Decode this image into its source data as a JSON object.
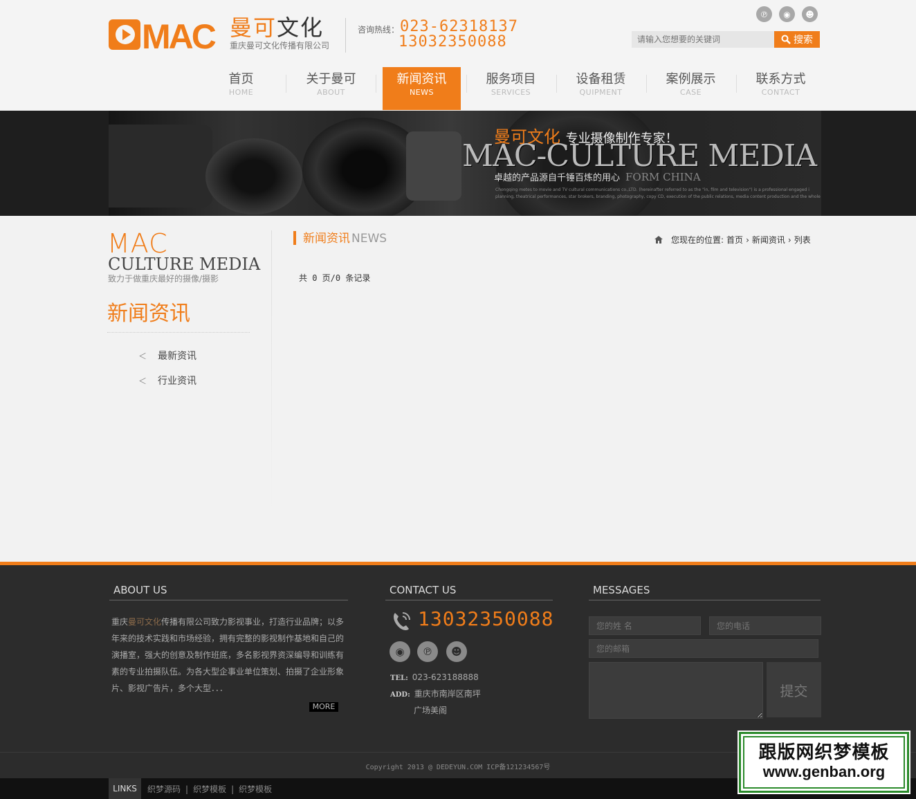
{
  "header": {
    "logo_text": "MAC",
    "logo_cn_a": "曼可",
    "logo_cn_b": "文化",
    "logo_sub": "重庆曼可文化传播有限公司",
    "hotline_label": "咨询热线：",
    "hotline_1": "023-62318137",
    "hotline_2": "13032350088",
    "search_placeholder": "请输入您想要的关键词",
    "search_button": "搜索"
  },
  "nav": [
    {
      "cn": "首页",
      "en": "HOME"
    },
    {
      "cn": "关于曼可",
      "en": "ABOUT"
    },
    {
      "cn": "新闻资讯",
      "en": "NEWS"
    },
    {
      "cn": "服务项目",
      "en": "SERVICES"
    },
    {
      "cn": "设备租赁",
      "en": "QUIPMENT"
    },
    {
      "cn": "案例展示",
      "en": "CASE"
    },
    {
      "cn": "联系方式",
      "en": "CONTACT"
    }
  ],
  "banner": {
    "title_cn": "曼可文化",
    "title_rest": "专业摄像制作专家！",
    "big": "MAC-CULTURE MEDIA",
    "slogan": "卓越的产品源自千锤百炼的用心",
    "slogan_en": "FORM CHINA",
    "fine_1": "Chongqing metes to movie and TV cultural communications co.,LTD. (hereinafter referred to as the \"in, film and television\") is a professional engaged i",
    "fine_2": "planning, theatrical performances, star brokers, branding, photography, copy CD, execution of the public relations, media content production and the whole value chain of"
  },
  "side": {
    "mac": "MAC",
    "culture": "CULTURE MEDIA",
    "slogan": "致力于做重庆最好的摄像/摄影",
    "title": "新闻资讯",
    "items": [
      "最新资讯",
      "行业资讯"
    ]
  },
  "main": {
    "title_cn": "新闻资讯",
    "title_en": "NEWS",
    "breadcrumb_label": "您现在的位置:",
    "breadcrumb": [
      "首页",
      "新闻资讯",
      "列表"
    ],
    "records": "共 0 页/0 条记录"
  },
  "footer": {
    "about_head": "ABOUT US",
    "about_pre": "重庆",
    "about_hl": "曼可文化",
    "about_rest": "传播有限公司致力影视事业，打造行业品牌；以多年来的技术实践和市场经验，拥有完整的影视制作基地和自己的演播室，强大的创意及制作班底，多名影视界资深编导和训练有素的专业拍摄队伍。为各大型企事业单位策划、拍摄了企业形象片、影视广告片，多个大型．．．",
    "more": "MORE",
    "contact_head": "CONTACT US",
    "contact_phone": "13032350088",
    "tel_label": "TEL:",
    "tel": "023-623188888",
    "add_label": "ADD:",
    "add_1": "重庆市南岸区南坪",
    "add_2": "广场美阁",
    "messages_head": "MESSAGES",
    "name_placeholder": "您的姓 名",
    "phone_placeholder": "您的电话",
    "email_placeholder": "您的邮箱",
    "submit": "提交",
    "copyright": "Copyright 2013 @ DEDEYUN.COM  ICP备121234567号",
    "links_label": "LINKS",
    "links": [
      "织梦源码",
      "织梦模板",
      "织梦模板"
    ]
  },
  "watermark": {
    "line1": "跟版网织梦模板",
    "line2": "www.genban.org"
  },
  "colors": {
    "accent": "#f07d1a",
    "footer_bg": "#2c2c2c",
    "banner_bg": "#1e1e1e"
  }
}
